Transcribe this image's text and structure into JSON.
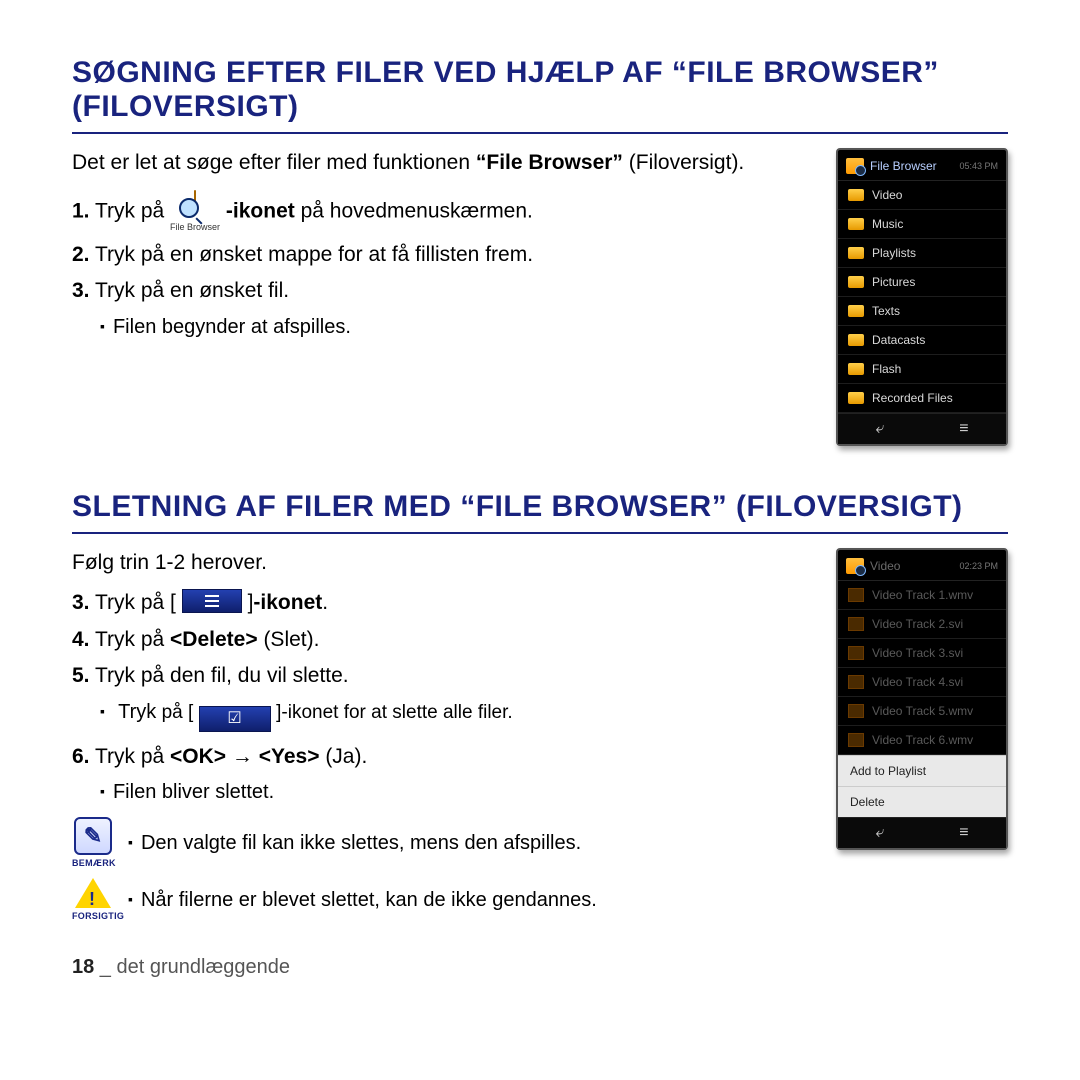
{
  "section1": {
    "title": "SØGNING EFTER FILER VED HJÆLP AF “FILE BROWSER” (FILOVERSIGT)",
    "intro1": "Det er let at søge efter filer med funktionen ",
    "intro1_bold": "“File Browser”",
    "intro2": " (Filoversigt).",
    "step1a": "1.",
    "step1b": " Tryk på ",
    "step1_icon_label": "File Browser",
    "step1c": "-ikonet",
    "step1d": " på hovedmenuskærmen.",
    "step2a": "2.",
    "step2b": " Tryk på en ønsket mappe for at få fillisten frem.",
    "step3a": "3.",
    "step3b": " Tryk på en ønsket fil.",
    "sub3": "Filen begynder at afspilles."
  },
  "device1": {
    "title": "File Browser",
    "time": "05:43 PM",
    "folders": [
      "Video",
      "Music",
      "Playlists",
      "Pictures",
      "Texts",
      "Datacasts",
      "Flash",
      "Recorded Files"
    ]
  },
  "section2": {
    "title": "SLETNING AF FILER MED “FILE BROWSER” (FILOVERSIGT)",
    "intro": "Følg trin 1-2 herover.",
    "s3a": "3.",
    "s3b": " Tryk på [ ",
    "s3c": " ]",
    "s3d": "-ikonet",
    "s3e": ".",
    "s4a": "4.",
    "s4b": " Tryk på ",
    "s4c": "<Delete>",
    "s4d": " (Slet).",
    "s5a": "5.",
    "s5b": " Tryk på den fil, du vil slette.",
    "sub5a": "Tryk",
    "sub5b": " på [ ",
    "sub5c": " ]-ikonet for at slette alle filer.",
    "s6a": "6.",
    "s6b": " Tryk på ",
    "s6c": "<OK>",
    "s6d": " → ",
    "s6e": "<Yes>",
    "s6f": " (Ja).",
    "sub6": "Filen bliver slettet."
  },
  "device2": {
    "title": "Video",
    "time": "02:23 PM",
    "files": [
      "Video Track 1.wmv",
      "Video Track 2.svi",
      "Video Track 3.svi",
      "Video Track 4.svi",
      "Video Track 5.wmv",
      "Video Track 6.wmv"
    ],
    "menu": [
      "Add to Playlist",
      "Delete"
    ]
  },
  "notes": {
    "note_label": "BEMÆRK",
    "note_text": "Den valgte fil kan ikke slettes, mens den afspilles.",
    "caution_label": "FORSIGTIG",
    "caution_text": "Når filerne er blevet slettet, kan de ikke gendannes."
  },
  "footer": {
    "page": "18",
    "sep": " _ ",
    "section": "det grundlæggende"
  }
}
